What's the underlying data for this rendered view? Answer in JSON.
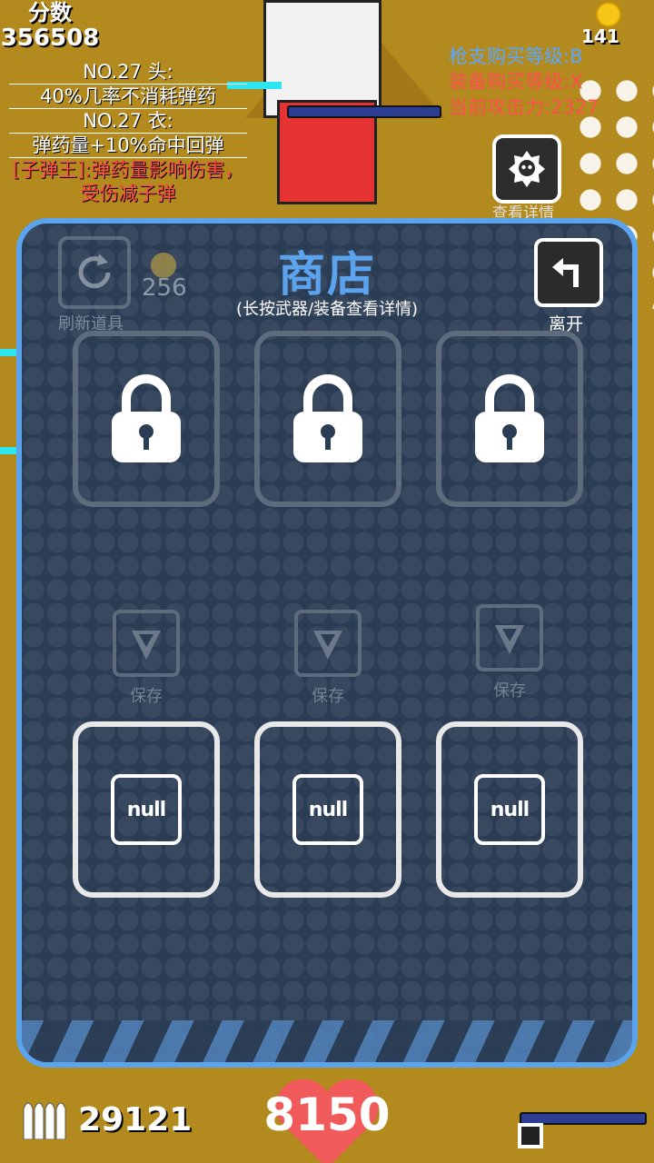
{
  "hud": {
    "score_label": "分数",
    "score_value": "356508",
    "coins": "141",
    "ammo": "29121",
    "hp": "8150"
  },
  "buffs": [
    "NO.27 头:",
    "40%几率不消耗弹药",
    "NO.27 衣:",
    "弹药量+10%命中回弹",
    "[子弹王]:弹药量影响伤害，受伤减子弹"
  ],
  "levels": {
    "gun_level": "枪支购买等级:B",
    "gear_level": "装备购买等级:X",
    "attack": "当前攻击力:2327"
  },
  "detail_label": "查看详情",
  "shop": {
    "title": "商店",
    "subtitle": "(长按武器/装备查看详情)",
    "refresh_label": "刷新道具",
    "refresh_cost": "256",
    "leave_label": "离开",
    "save_label": "保存",
    "null_label": "null"
  },
  "colors": {
    "panel_bg": "#2b3d55",
    "panel_border": "#5ba3ec",
    "title": "#5ba3ec",
    "red_text": "#ff4a4a"
  }
}
